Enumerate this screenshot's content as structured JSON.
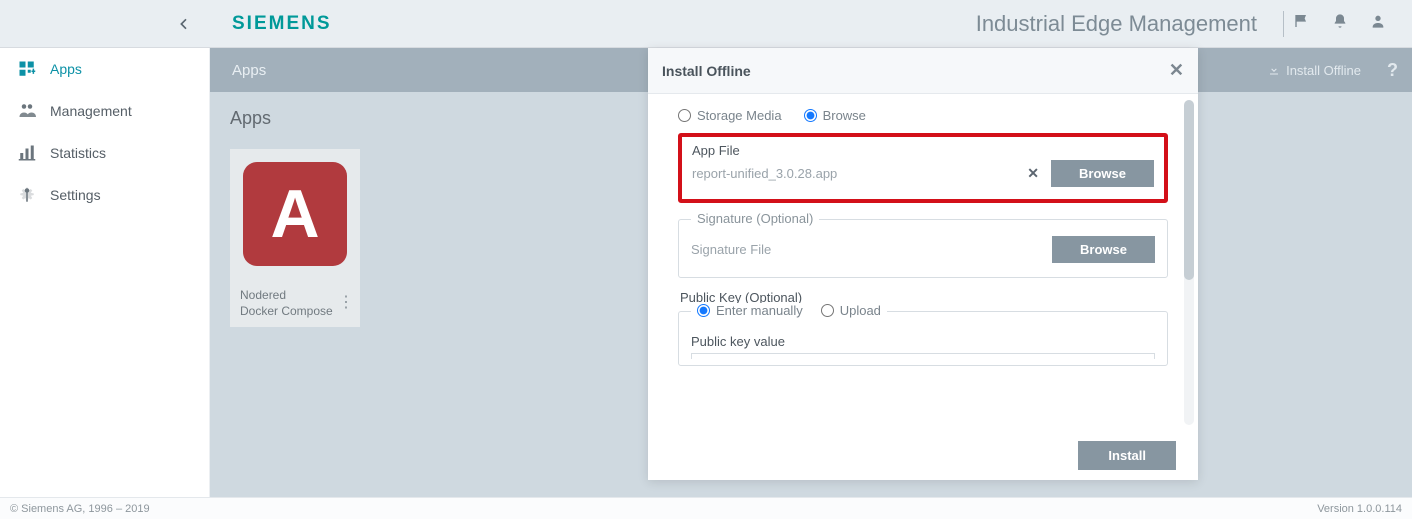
{
  "brand": "SIEMENS",
  "header_title": "Industrial Edge Management",
  "sidebar": {
    "items": [
      {
        "label": "Apps"
      },
      {
        "label": "Management"
      },
      {
        "label": "Statistics"
      },
      {
        "label": "Settings"
      }
    ]
  },
  "subheader": {
    "title": "Apps",
    "install_offline": "Install Offline",
    "help": "?"
  },
  "apps_panel": {
    "heading": "Apps",
    "card": {
      "letter": "A",
      "line1": "Nodered",
      "line2": "Docker Compose"
    }
  },
  "modal": {
    "title": "Install Offline",
    "source": {
      "storage_media": "Storage Media",
      "browse": "Browse"
    },
    "app_file": {
      "label": "App File",
      "filename": "report-unified_3.0.28.app",
      "browse_btn": "Browse"
    },
    "signature": {
      "legend": "Signature (Optional)",
      "label": "Signature File",
      "browse_btn": "Browse"
    },
    "public_key": {
      "section": "Public Key (Optional)",
      "enter_manually": "Enter manually",
      "upload": "Upload",
      "value_label": "Public key value"
    },
    "install_btn": "Install"
  },
  "footer": {
    "left": "© Siemens AG, 1996 – 2019",
    "right": "Version 1.0.0.114"
  }
}
